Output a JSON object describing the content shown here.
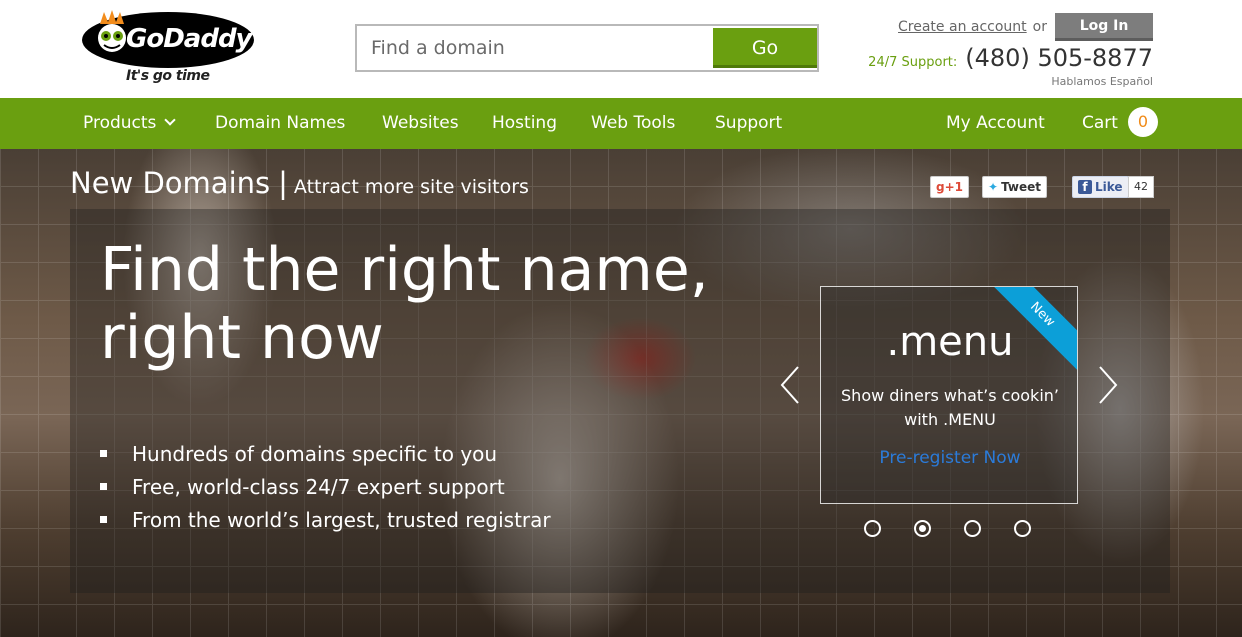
{
  "header": {
    "logo_text": "GoDaddy",
    "logo_tagline": "It's go time",
    "search_placeholder": "Find a domain",
    "search_button": "Go",
    "create_account": "Create an account",
    "or_text": "or",
    "login_button": "Log In",
    "support_label": "24/7 Support:",
    "support_phone": "(480) 505-8877",
    "support_language": "Hablamos Español"
  },
  "nav": {
    "products": "Products",
    "domain_names": "Domain Names",
    "websites": "Websites",
    "hosting": "Hosting",
    "web_tools": "Web Tools",
    "support": "Support",
    "my_account": "My Account",
    "cart": "Cart",
    "cart_count": "0"
  },
  "hero": {
    "section_title": "New Domains",
    "section_separator": "|",
    "section_subtitle": "Attract more site visitors",
    "headline_line1": "Find the right name,",
    "headline_line2": "right now",
    "bullets": [
      "Hundreds of domains specific to you",
      "Free, world-class 24/7 expert support",
      "From the world’s largest, trusted registrar"
    ]
  },
  "social": {
    "gplus": "+1",
    "tweet": "Tweet",
    "like": "Like",
    "like_count": "42"
  },
  "promo": {
    "ribbon": "New",
    "name": ".menu",
    "description": "Show diners what’s cookin’ with .MENU",
    "link": "Pre-register Now"
  },
  "carousel": {
    "total": 4,
    "active": 2
  },
  "colors": {
    "brand_green": "#6a9f10",
    "ribbon_blue": "#0c9fd8",
    "link_blue": "#2b7bd9",
    "cart_orange": "#f08a17"
  }
}
